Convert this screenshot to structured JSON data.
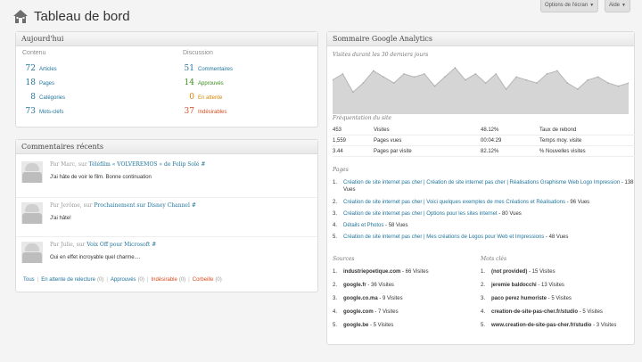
{
  "header": {
    "title": "Tableau de bord",
    "screen_options_label": "Options de l'écran",
    "help_label": "Aide"
  },
  "today": {
    "title": "Aujourd'hui",
    "content_label": "Contenu",
    "discussion_label": "Discussion",
    "content": [
      {
        "count": "72",
        "label": "Articles"
      },
      {
        "count": "18",
        "label": "Pages"
      },
      {
        "count": "8",
        "label": "Catégories"
      },
      {
        "count": "73",
        "label": "Mots-clefs"
      }
    ],
    "discussion": [
      {
        "count": "51",
        "label": "Commentaires"
      },
      {
        "count": "14",
        "label": "Approuvés"
      },
      {
        "count": "0",
        "label": "En attente"
      },
      {
        "count": "37",
        "label": "Indésirables"
      }
    ]
  },
  "comments": {
    "title": "Commentaires récents",
    "items": [
      {
        "by": "Par Marc, sur",
        "post": "Téléfilm « VOLVEREMOS » de Felip Solé",
        "hash": "#",
        "text": "J'ai hâte de voir le film. Bonne continuation"
      },
      {
        "by": "Par Jerôme, sur",
        "post": "Prochainement sur Disney Channel",
        "hash": "#",
        "text": "J'ai hâte!"
      },
      {
        "by": "Par Julie, sur",
        "post": "Voix Off pour Microsoft",
        "hash": "#",
        "text": "Oui en effet incroyable quel charme...."
      }
    ],
    "links": [
      {
        "label": "Tous",
        "count": ""
      },
      {
        "label": "En attente de relecture",
        "count": "(0)"
      },
      {
        "label": "Approuvés",
        "count": "(0)"
      },
      {
        "label": "Indésirable",
        "count": "(0)"
      },
      {
        "label": "Corbeille",
        "count": "(0)"
      }
    ]
  },
  "analytics": {
    "title": "Sommaire Google Analytics",
    "visits_label": "Visites durant les 30 derniers jours",
    "frequency_label": "Fréquentation du site",
    "stats": [
      {
        "v1": "453",
        "l1": "Visites",
        "v2": "48.12%",
        "l2": "Taux de rebond"
      },
      {
        "v1": "1,559",
        "l1": "Pages vues",
        "v2": "00:04:29",
        "l2": "Temps moy. visite"
      },
      {
        "v1": "3.44",
        "l1": "Pages par visite",
        "v2": "82.12%",
        "l2": "% Nouvelles visites"
      }
    ],
    "pages_label": "Pages",
    "pages": [
      {
        "n": "1.",
        "title": "Création de site internet pas cher | Création de site internet pas cher | Réalisations Graphisme Web Logo Impression",
        "views": " - 138 Vues"
      },
      {
        "n": "2.",
        "title": "Création de site internet pas cher | Voici quelques exemples de mes Créations et Réalisations",
        "views": " - 96 Vues"
      },
      {
        "n": "3.",
        "title": "Création de site internet pas cher | Options pour les sites internet",
        "views": " - 80 Vues"
      },
      {
        "n": "4.",
        "title": "Détails et Photos",
        "views": " - 58 Vues"
      },
      {
        "n": "5.",
        "title": "Création de site internet pas cher | Mes créations de Logos pour Web et Impressions",
        "views": " - 48 Vues"
      }
    ],
    "sources_label": "Sources",
    "sources": [
      {
        "n": "1.",
        "name": "industriepoetique.com",
        "visits": " - 66 Visites"
      },
      {
        "n": "2.",
        "name": "google.fr",
        "visits": " - 36 Visites"
      },
      {
        "n": "3.",
        "name": "google.co.ma",
        "visits": " - 9 Visites"
      },
      {
        "n": "4.",
        "name": "google.com",
        "visits": " - 7 Visites"
      },
      {
        "n": "5.",
        "name": "google.be",
        "visits": " - 5 Visites"
      }
    ],
    "keywords_label": "Mots clés",
    "keywords": [
      {
        "n": "1.",
        "name": "(not provided)",
        "visits": " - 15 Visites"
      },
      {
        "n": "2.",
        "name": "jeremie baldocchi",
        "visits": " - 13 Visites"
      },
      {
        "n": "3.",
        "name": "paco perez humoriste",
        "visits": " - 5 Visites"
      },
      {
        "n": "4.",
        "name": "creation-de-site-pas-cher.fr/studio",
        "visits": " - 5 Visites"
      },
      {
        "n": "5.",
        "name": "www.creation-de-site-pas-cher.fr/studio",
        "visits": " - 3 Visites"
      }
    ]
  },
  "chart_data": {
    "type": "area",
    "values": [
      10,
      12,
      6,
      9,
      13,
      11,
      9,
      12,
      11,
      12,
      8,
      11,
      14,
      10,
      12,
      9,
      12,
      7,
      11,
      10,
      9,
      12,
      13,
      9,
      7,
      10,
      11,
      9,
      8,
      9
    ],
    "color": "#d5d5d5"
  }
}
